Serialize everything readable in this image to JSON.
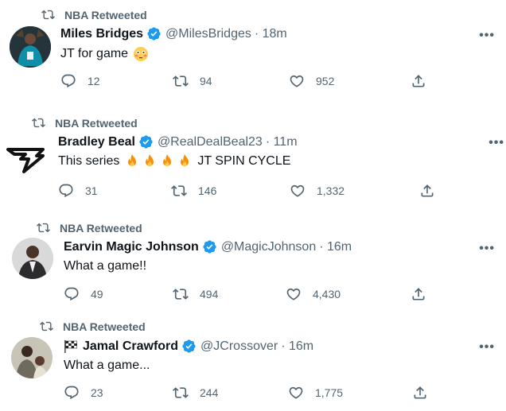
{
  "tweets": [
    {
      "retweeted_by": "NBA Retweeted",
      "name": "Miles Bridges",
      "handle": "@MilesBridges",
      "time": "· 18m",
      "text": "JT for game",
      "emoji": "flushed-face",
      "replies": "12",
      "retweets": "94",
      "likes": "952"
    },
    {
      "retweeted_by": "NBA Retweeted",
      "name": "Bradley Beal",
      "handle": "@RealDealBeal23",
      "time": "· 11m",
      "text_prefix": "This series",
      "text_suffix": "JT SPIN CYCLE",
      "emoji": "fire",
      "replies": "31",
      "retweets": "146",
      "likes": "1,332"
    },
    {
      "retweeted_by": "NBA Retweeted",
      "name": "Earvin Magic Johnson",
      "handle": "@MagicJohnson",
      "time": "· 16m",
      "text": "What a game!!",
      "replies": "49",
      "retweets": "494",
      "likes": "4,430"
    },
    {
      "retweeted_by": "NBA Retweeted",
      "name": "Jamal Crawford",
      "handle": "@JCrossover",
      "time": "· 16m",
      "text": "What a game...",
      "emoji": "checkered-flag",
      "replies": "23",
      "retweets": "244",
      "likes": "1,775"
    }
  ],
  "colors": {
    "verified": "#1d9bf0",
    "secondary_text": "#536471",
    "primary_text": "#0f1419"
  },
  "icons": [
    "retweet-icon",
    "reply-icon",
    "like-icon",
    "share-icon",
    "verified-badge-icon",
    "more-icon"
  ]
}
